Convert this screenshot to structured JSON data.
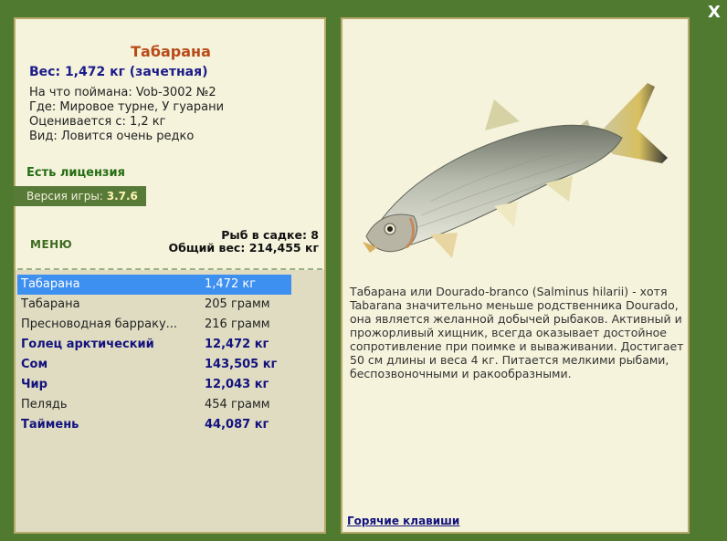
{
  "close": "X",
  "fish": {
    "name": "Табарана",
    "weight": "Вес: 1,472 кг (зачетная)",
    "caught_with": "На что поймана: Vob-3002 №2",
    "where": "Где: Мировое турне, У гуарани",
    "valued_from": "Оценивается с: 1,2 кг",
    "kind": "Вид: Ловится очень редко"
  },
  "license": "Есть лицензия",
  "version_label": "Версия игры:",
  "version": "3.7.6",
  "menu_label": "МЕНЮ",
  "keepnet": {
    "count": "Рыб в садке: 8",
    "total": "Общий вес: 214,455 кг"
  },
  "catch_list": [
    {
      "name": "Табарана",
      "weight": "1,472 кг"
    },
    {
      "name": "Табарана",
      "weight": "205 грамм"
    },
    {
      "name": "Пресноводная барраку...",
      "weight": "216 грамм"
    },
    {
      "name": "Голец арктический",
      "weight": "12,472 кг"
    },
    {
      "name": "Сом",
      "weight": "143,505 кг"
    },
    {
      "name": "Чир",
      "weight": "12,043 кг"
    },
    {
      "name": "Пелядь",
      "weight": "454 грамм"
    },
    {
      "name": "Таймень",
      "weight": "44,087 кг"
    }
  ],
  "description": "Табарана или Dourado-branco (Salminus hilarii) - хотя Tabarana значительно меньше родственника Dourado, она является желанной добычей рыбаков. Активный и прожорливый хищник, всегда оказывает достойное сопротивление при поимке и вываживании. Достигает 50 см длины и веса 4 кг. Питается мелкими рыбами, беспозвоночными и ракообразными.",
  "hotkeys": "Горячие клавиши",
  "colors": {
    "background": "#4f7a30",
    "panel": "#f5f3dc",
    "selected": "#3d8ff0",
    "title": "#b84a17"
  }
}
